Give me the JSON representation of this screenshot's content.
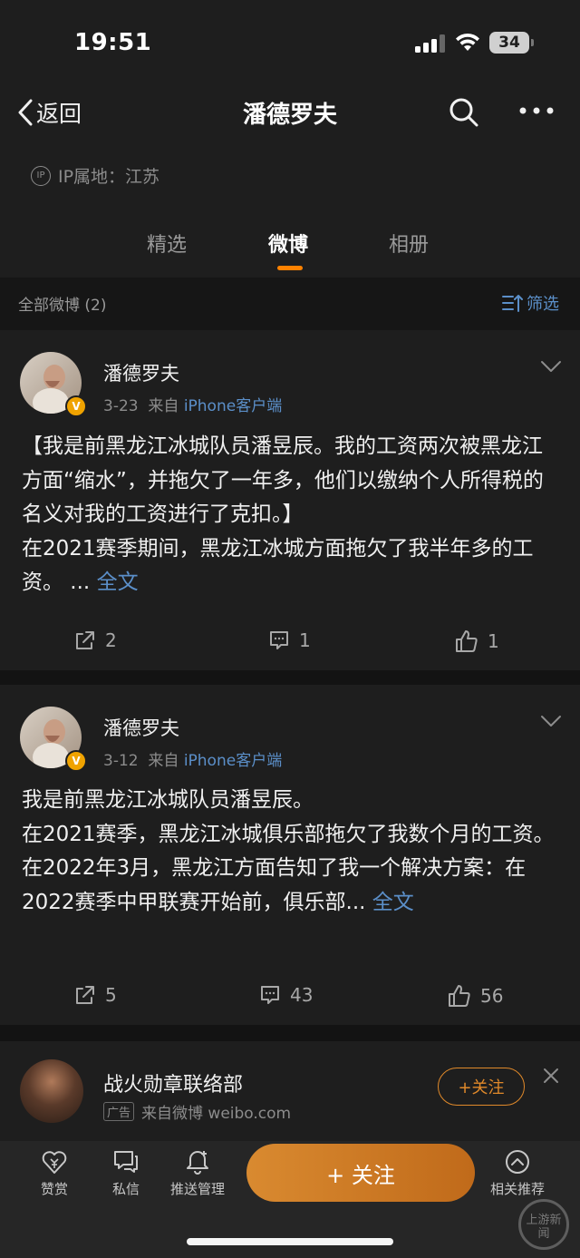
{
  "status_bar": {
    "time": "19:51",
    "battery": "34"
  },
  "nav": {
    "back_label": "返回",
    "title": "潘德罗夫"
  },
  "profile": {
    "ip_badge": "IP",
    "ip_location": "IP属地：江苏"
  },
  "tabs": [
    {
      "label": "精选",
      "active": false
    },
    {
      "label": "微博",
      "active": true
    },
    {
      "label": "相册",
      "active": false
    }
  ],
  "filter": {
    "label": "全部微博 (2)",
    "button": "筛选"
  },
  "posts": [
    {
      "author": "潘德罗夫",
      "date": "3-23",
      "source_prefix": "来自",
      "source": "iPhone客户端",
      "text": "【我是前黑龙江冰城队员潘昱辰。我的工资两次被黑龙江方面“缩水”，并拖欠了一年多，他们以缴纳个人所得税的名义对我的工资进行了克扣。】\n在2021赛季期间，黑龙江冰城方面拖欠了我半年多的工资。 ... ",
      "full_text_link": "全文",
      "reposts": "2",
      "comments": "1",
      "likes": "1"
    },
    {
      "author": "潘德罗夫",
      "date": "3-12",
      "source_prefix": "来自",
      "source": "iPhone客户端",
      "text": "我是前黑龙江冰城队员潘昱辰。\n在2021赛季，黑龙江冰城俱乐部拖欠了我数个月的工资。\n在2022年3月，黑龙江方面告知了我一个解决方案：在2022赛季中甲联赛开始前，俱乐部... ",
      "full_text_link": "全文",
      "reposts": "5",
      "comments": "43",
      "likes": "56"
    }
  ],
  "ad": {
    "name": "战火勋章联络部",
    "tag": "广告",
    "source": "来自微博 weibo.com",
    "follow": "+关注"
  },
  "bottom_bar": {
    "reward": "赞赏",
    "message": "私信",
    "push": "推送管理",
    "follow": "+ 关注",
    "related": "相关推荐"
  },
  "watermark": "上游新闻",
  "colors": {
    "accent": "#ff8200",
    "link": "#5b8fc9",
    "follow_gradient": "#d98a30"
  }
}
